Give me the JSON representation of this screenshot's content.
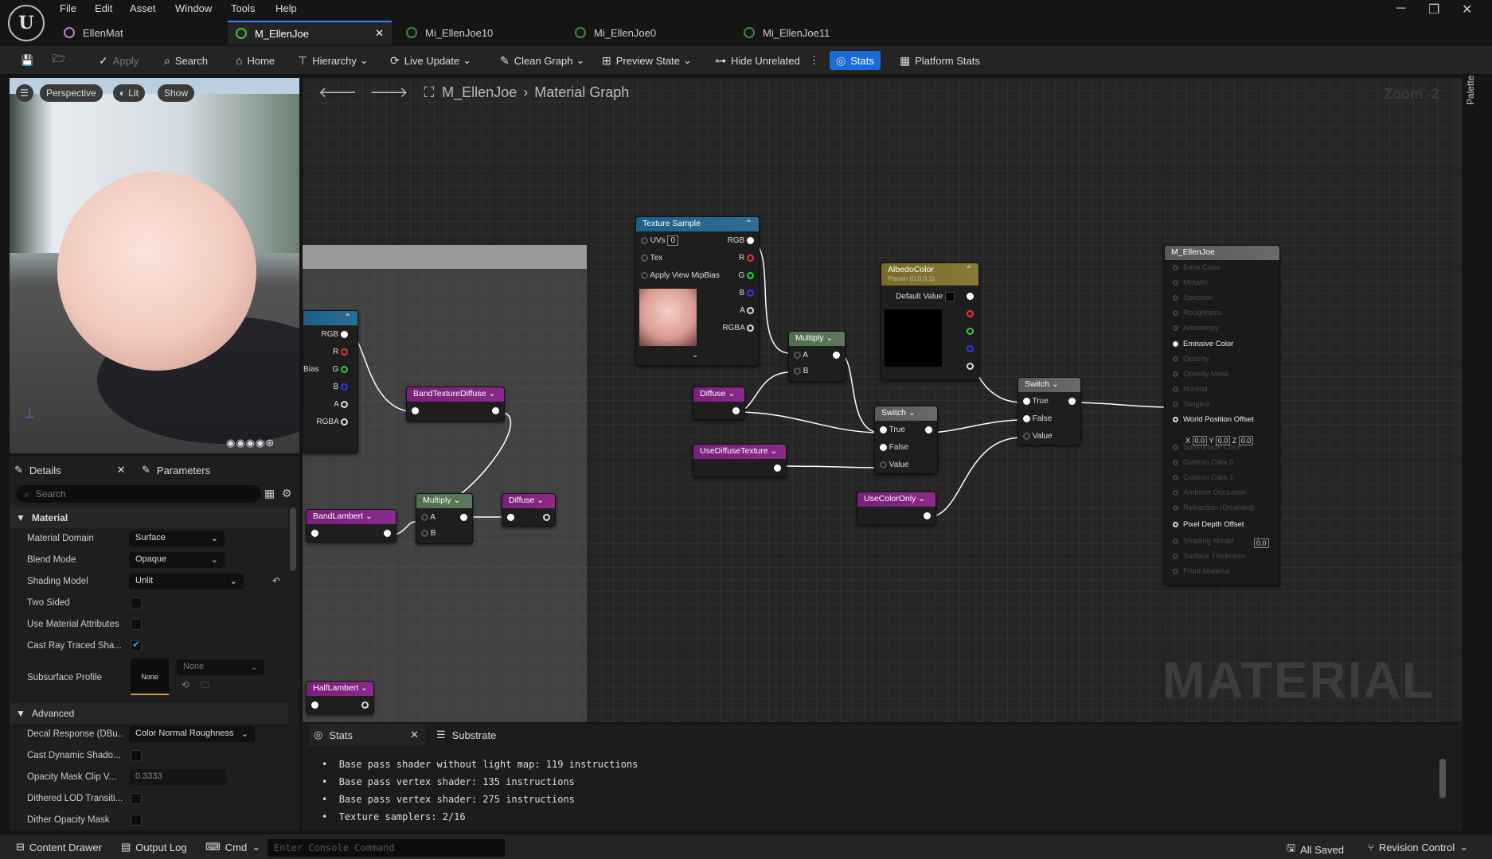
{
  "menu": [
    "File",
    "Edit",
    "Asset",
    "Window",
    "Tools",
    "Help"
  ],
  "tabs": [
    {
      "label": "EllenMat"
    },
    {
      "label": "M_EllenJoe"
    },
    {
      "label": "Mi_EllenJoe10"
    },
    {
      "label": "Mi_EllenJoe0"
    },
    {
      "label": "Mi_EllenJoe11"
    }
  ],
  "toolbar": {
    "apply": "Apply",
    "search": "Search",
    "home": "Home",
    "hierarchy": "Hierarchy",
    "live_update": "Live Update",
    "clean_graph": "Clean Graph",
    "preview_state": "Preview State",
    "hide_unrelated": "Hide Unrelated",
    "stats": "Stats",
    "platform_stats": "Platform Stats"
  },
  "viewport": {
    "perspective": "Perspective",
    "lit": "Lit",
    "show": "Show"
  },
  "details": {
    "tab": "Details",
    "params_tab": "Parameters",
    "search_placeholder": "Search",
    "section_material": "Material",
    "section_advanced": "Advanced",
    "rows": [
      {
        "label": "Material Domain",
        "value": "Surface"
      },
      {
        "label": "Blend Mode",
        "value": "Opaque"
      },
      {
        "label": "Shading Model",
        "value": "Unlit"
      },
      {
        "label": "Two Sided"
      },
      {
        "label": "Use Material Attributes"
      },
      {
        "label": "Cast Ray Traced Sha..."
      }
    ],
    "subsurface_label": "Subsurface Profile",
    "subsurface_thumb": "None",
    "subsurface_value": "None",
    "adv_rows": [
      {
        "label": "Decal Response (DBu...",
        "value": "Color Normal Roughness"
      },
      {
        "label": "Cast Dynamic Shado..."
      },
      {
        "label": "Opacity Mask Clip V...",
        "value": "0.3333"
      },
      {
        "label": "Dithered LOD Transiti..."
      },
      {
        "label": "Dither Opacity Mask"
      }
    ]
  },
  "graph": {
    "asset": "M_EllenJoe",
    "view": "Material Graph",
    "zoom": "Zoom -2",
    "palette": "Palette",
    "watermark": "MATERIAL",
    "nodes": {
      "texture_sample": "Texture Sample",
      "albedo": "AlbedoColor",
      "albedo_sub": "Param (0,0,0,1)",
      "default_value": "Default Value",
      "multiply": "Multiply",
      "switch": "Switch",
      "diffuse": "Diffuse",
      "use_diffuse_texture": "UseDiffuseTexture",
      "use_color_only": "UseColorOnly",
      "band_texture": "BandTextureDiffuse",
      "band_lambert": "BandLambert",
      "half_lambert": "HalfLambert",
      "result": "M_EllenJoe"
    },
    "pins": {
      "uvs": "UVs",
      "uvs_val": "0",
      "tex": "Tex",
      "mip": "Apply View MipBias",
      "rgb": "RGB",
      "r": "R",
      "g": "G",
      "b": "B",
      "a": "A",
      "rgba": "RGBA",
      "in_a": "A",
      "in_b": "B",
      "true": "True",
      "false": "False",
      "value": "Value",
      "bias": "Bias"
    },
    "result_pins": [
      "Base Color",
      "Metallic",
      "Specular",
      "Roughness",
      "Anisotropy",
      "Emissive Color",
      "Opacity",
      "Opacity Mask",
      "Normal",
      "Tangent",
      "World Position Offset",
      "Subsurface Color",
      "Custom Data 0",
      "Custom Data 1",
      "Ambient Occlusion",
      "Refraction (Disabled)",
      "Pixel Depth Offset",
      "Shading Model",
      "Surface Thickness",
      "Front Material"
    ],
    "wpo": {
      "x": "0.0",
      "y": "0.0",
      "z": "0.0"
    },
    "pdo": "0.0"
  },
  "stats": {
    "tab": "Stats",
    "tab2": "Substrate",
    "lines": [
      "Base pass shader without light map: 119 instructions",
      "Base pass vertex shader: 135 instructions",
      "Base pass vertex shader: 275 instructions",
      "Texture samplers: 2/16"
    ]
  },
  "status": {
    "content_drawer": "Content Drawer",
    "output_log": "Output Log",
    "cmd": "Cmd",
    "console_placeholder": "Enter Console Command",
    "all_saved": "All Saved",
    "revision": "Revision Control"
  }
}
